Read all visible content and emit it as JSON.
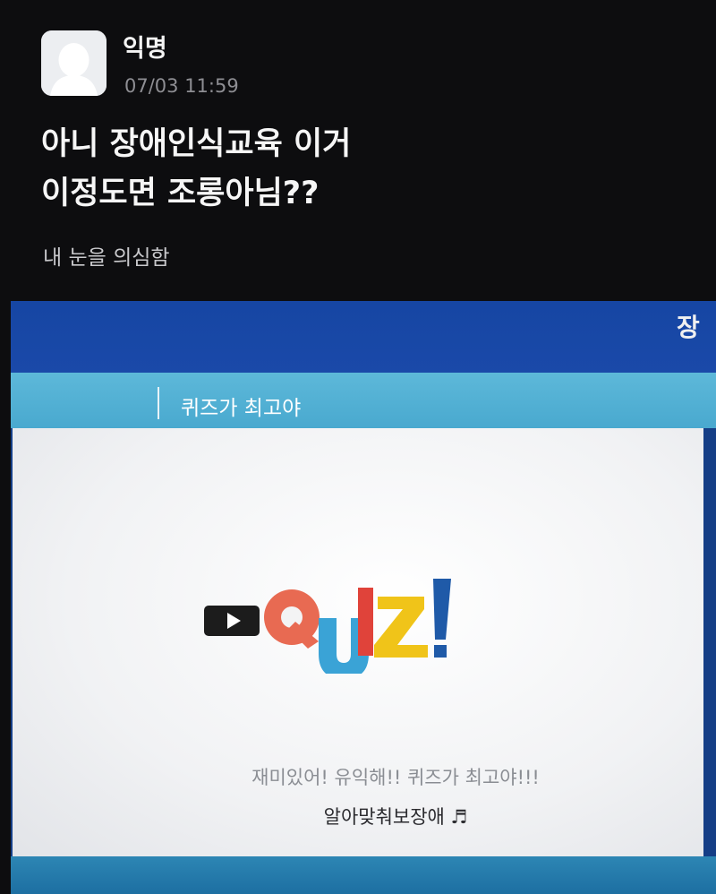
{
  "post": {
    "username": "익명",
    "timestamp": "07/03 11:59",
    "title_lines": [
      "아니 장애인식교육 이거",
      "이정도면 조롱아님??"
    ],
    "body": "내 눈을 의심함",
    "avatar_icon": "default-avatar-icon"
  },
  "photo": {
    "corner_text": "장",
    "banner_title": "퀴즈가 최고야",
    "logo_text": "QUIZ!",
    "logo_colors": {
      "play_box": "#1c1c1c",
      "Q": "#e86a52",
      "U": "#3aa3d6",
      "I": "#e0433a",
      "Z": "#f0c419",
      "bang": "#1f5aa8"
    },
    "tagline": "재미있어! 유익해!! 퀴즈가 최고야!!!",
    "sing_line": "알아맞춰보장애 ♬"
  }
}
